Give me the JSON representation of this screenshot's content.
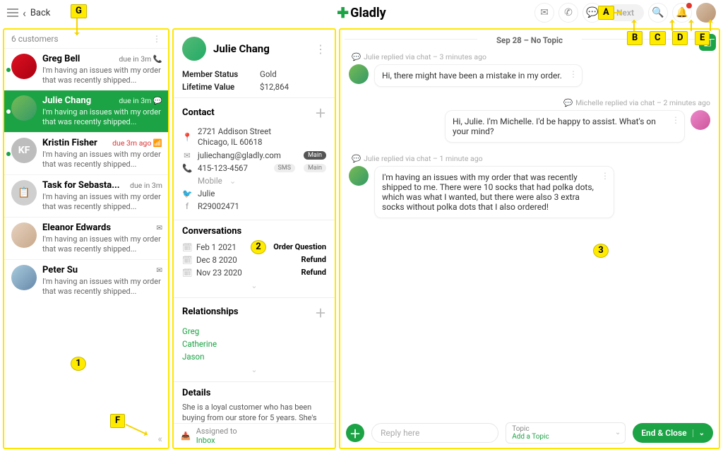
{
  "topbar": {
    "back": "Back",
    "brand": "Gladly",
    "next": "Next"
  },
  "inbox": {
    "count_label": "6 customers",
    "items": [
      {
        "name": "Greg Bell",
        "due": "due in 3m",
        "due_red": false,
        "snippet": "I'm having an issues with my order that was recently shipped...",
        "online": true,
        "initials": "",
        "av_bg": "linear-gradient(135deg,#d12,#a01)",
        "icon": "phone"
      },
      {
        "name": "Julie Chang",
        "due": "due in 3m",
        "due_red": false,
        "snippet": "I'm having an issues with my order that was recently shipped...",
        "online": true,
        "initials": "",
        "av_bg": "linear-gradient(135deg,#7b5,#396)",
        "icon": "chat",
        "active": true
      },
      {
        "name": "Kristin Fisher",
        "due": "due 3m ago",
        "due_red": true,
        "snippet": "I'm having an issues with my order that was recently shipped...",
        "online": true,
        "initials": "KF",
        "av_bg": "#bdbdbd",
        "icon": "wifi"
      },
      {
        "name": "Task for Sebasta...",
        "due": "due in 3m",
        "due_red": false,
        "snippet": "I'm having an issues with my order that was recently shipped...",
        "online": false,
        "initials": "📋",
        "av_bg": "#cfcfcf",
        "icon": ""
      },
      {
        "name": "Eleanor Edwards",
        "due": "",
        "due_red": false,
        "snippet": "I'm having an issues with my order that was recently shipped...",
        "online": false,
        "initials": "",
        "av_bg": "linear-gradient(135deg,#e6d2c0,#c8a88a)",
        "icon": "mail"
      },
      {
        "name": "Peter Su",
        "due": "",
        "due_red": false,
        "snippet": "I'm having an issues with my order that was recently shipped...",
        "online": false,
        "initials": "",
        "av_bg": "linear-gradient(135deg,#acd,#68a)",
        "icon": "mail"
      }
    ]
  },
  "profile": {
    "name": "Julie Chang",
    "member_status_k": "Member Status",
    "member_status_v": "Gold",
    "ltv_k": "Lifetime Value",
    "ltv_v": "$12,864",
    "contact_h": "Contact",
    "address_l1": "2721 Addison Street",
    "address_l2": "Chicago, IL 60618",
    "email": "juliechang@gladly.com",
    "phone": "415-123-4567",
    "phone_kind": "Mobile",
    "twitter": "Julie",
    "facebook": "R29002471",
    "conv_h": "Conversations",
    "conversations": [
      {
        "date": "Feb 1 2021",
        "type": "Order Question"
      },
      {
        "date": "Dec 8 2020",
        "type": "Refund"
      },
      {
        "date": "Nov 23 2020",
        "type": "Refund"
      }
    ],
    "rel_h": "Relationships",
    "relationships": [
      "Greg",
      "Catherine",
      "Jason"
    ],
    "details_h": "Details",
    "details": "She is a loyal customer who has been buying from our store for 5 years. She's had a few issues with her recent online orders. If this",
    "assigned_k": "Assigned to",
    "assigned_v": "Inbox",
    "tag_main": "Main",
    "tag_sms": "SMS"
  },
  "convo": {
    "header": "Sep 28 – No Topic",
    "meta1": "Julie replied via chat – 3 minutes ago",
    "bubble1": "Hi, there might have been a mistake in my order.",
    "meta2": "Michelle replied via chat – 2 minutes ago",
    "bubble2": "Hi, Julie. I'm Michelle. I'd be happy to assist. What's on your mind?",
    "meta3": "Julie replied via chat – 1 minute ago",
    "bubble3": "I'm having an issues with my order that was recently shipped to me. There were 10 socks that had polka dots, which was what I wanted, but there were also 3 extra socks without polka dots that I also ordered!",
    "reply_placeholder": "Reply here",
    "topic_k": "Topic",
    "topic_v": "Add a Topic",
    "end": "End & Close"
  },
  "ann": {
    "A": "A",
    "B": "B",
    "C": "C",
    "D": "D",
    "E": "E",
    "F": "F",
    "G": "G",
    "n1": "1",
    "n2": "2",
    "n3": "3"
  }
}
